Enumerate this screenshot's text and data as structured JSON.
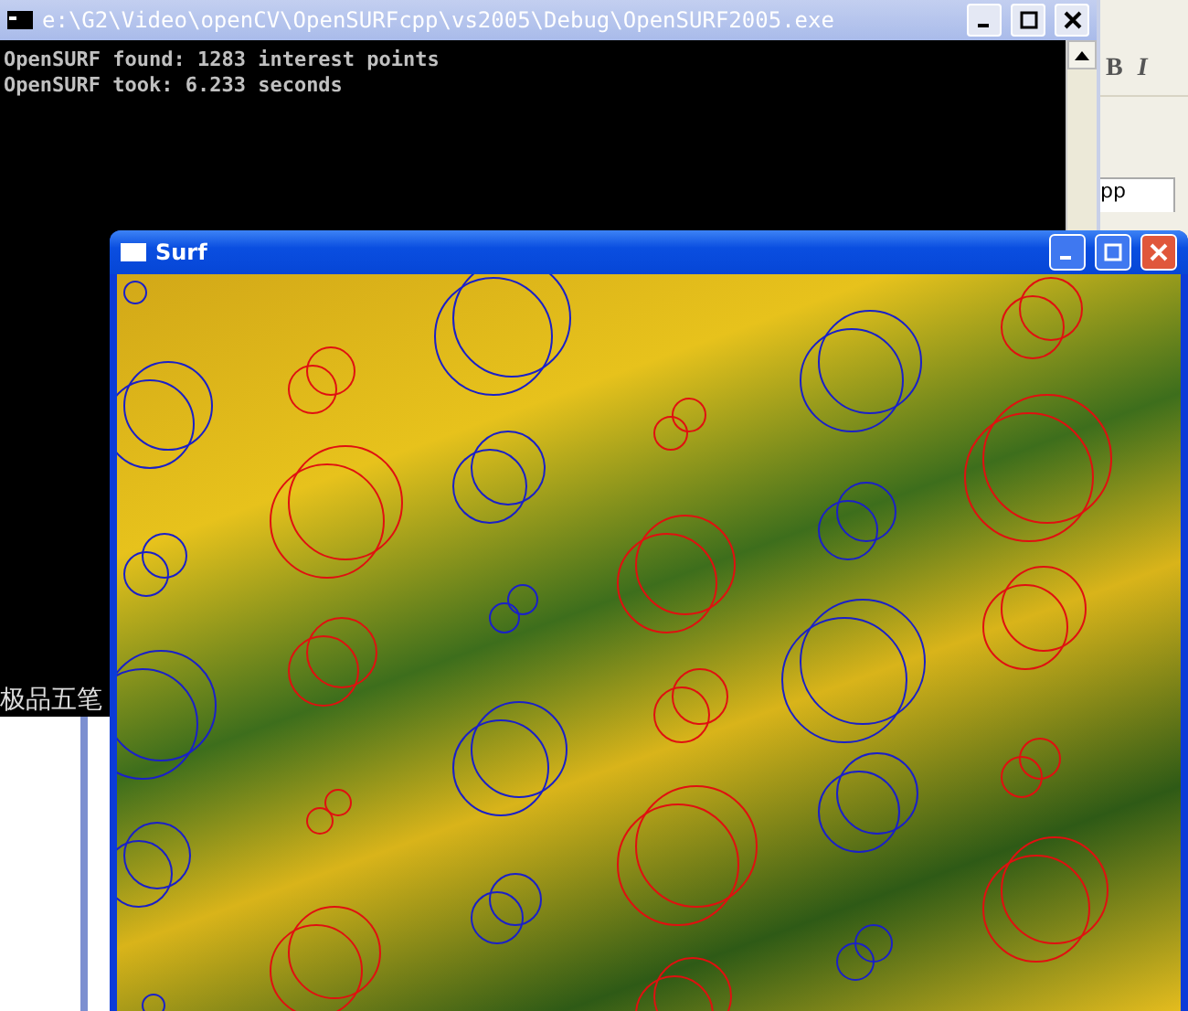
{
  "console_window": {
    "title": "e:\\G2\\Video\\openCV\\OpenSURFcpp\\vs2005\\Debug\\OpenSURF2005.exe",
    "lines": [
      "OpenSURF found: 1283 interest points",
      "OpenSURF took: 6.233 seconds"
    ]
  },
  "ime_status": {
    "label": "极品五笔"
  },
  "background_app": {
    "toolbar_buttons": [
      "B",
      "I"
    ],
    "tab": "pp"
  },
  "image_window": {
    "title": "Surf"
  }
}
